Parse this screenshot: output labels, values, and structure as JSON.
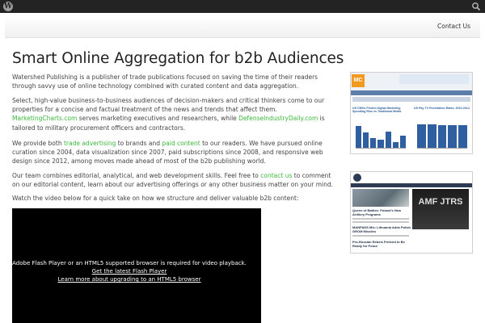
{
  "adminbar": {
    "logo_icon": "wordpress-icon",
    "search_icon": "search-icon"
  },
  "nav": {
    "contact": "Contact Us"
  },
  "main": {
    "title": "Smart Online Aggregation for b2b Audiences",
    "p1": "Watershed Publishing is a publisher of trade publications focused on saving the time of their readers through savvy use of online technology combined with curated content and data aggregation.",
    "p2": {
      "t1": "Select, high-value business-to-business audiences of decision-makers and critical thinkers come to our properties for a concise and factual treatment of the news and trends that affect them. ",
      "link1": "MarketingCharts.com",
      "t2": " serves marketing executives and researchers, while ",
      "link2": "DefenseIndustryDaily.com",
      "t3": " is tailored to military procurement officers and contractors."
    },
    "p3": {
      "t1": "We provide both ",
      "link1": "trade advertising",
      "t2": " to brands and ",
      "link2": "paid content",
      "t3": " to our readers. We have pursued online curation since 2004, data visualization since 2007, paid subscriptions since 2008, and responsive web design since 2012, among moves made ahead of most of the b2b publishing world."
    },
    "p4": {
      "t1": "Our team combines editorial, analytical, and web development skills. Feel free to ",
      "link1": "contact us",
      "t2": " to comment on our editorial content, learn about our advertising offerings or any other business matter on your mind."
    },
    "p5": "Watch the video below for a quick take on how we structure and deliver valuable b2b content:"
  },
  "video": {
    "message": "Adobe Flash Player or an HTML5 supported browser is required for video playback.",
    "link1": "Get the latest Flash Player",
    "link2": "Learn more about upgrading to an HTML5 browser"
  },
  "thumbs": {
    "mc": {
      "logo": "MC",
      "chart1_title": "US CMOs Predict Digital Marketing Spending Rise vs Traditional Media",
      "chart2_title": "US Pay TV Penetration Rates, 2010-2014"
    },
    "did": {
      "headline1": "Queen of Battles: Poland's New Artillery Programs",
      "headline2": "MANPADS Mix: Lithuania Adds Polish GROM Missiles",
      "headline3": "Pro-Russian Rebels Pretend to Be Ready for Peace",
      "ad_text": "AMF JTRS"
    }
  },
  "colors": {
    "link": "#3cb73c",
    "adminbar": "#232323"
  }
}
